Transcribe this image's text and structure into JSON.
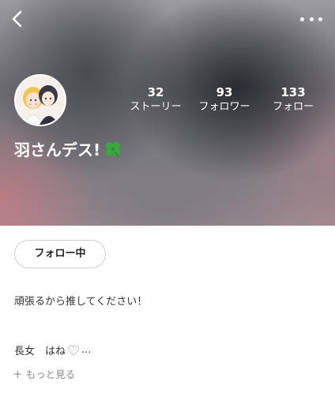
{
  "nav": {
    "back_icon": "chevron-left-icon",
    "more_icon": "more-horizontal-icon"
  },
  "profile": {
    "name": "羽さんデス!",
    "name_emoji": "four-leaf-clover-icon",
    "stats": [
      {
        "value": "32",
        "label": "ストーリー"
      },
      {
        "value": "93",
        "label": "フォロワー"
      },
      {
        "value": "133",
        "label": "フォロー"
      }
    ],
    "follow_button": "フォロー中",
    "bio_line1": "頑張るから推してください！",
    "bio_line2_prefix": "長女　はね",
    "bio_line2_suffix": "...",
    "bio_heart": "white-heart-icon",
    "more_link": "もっと見る",
    "more_link_icon": "+"
  },
  "colors": {
    "accent_text": "#333333",
    "muted": "#8a8a8a",
    "clover": "#3aa640"
  }
}
